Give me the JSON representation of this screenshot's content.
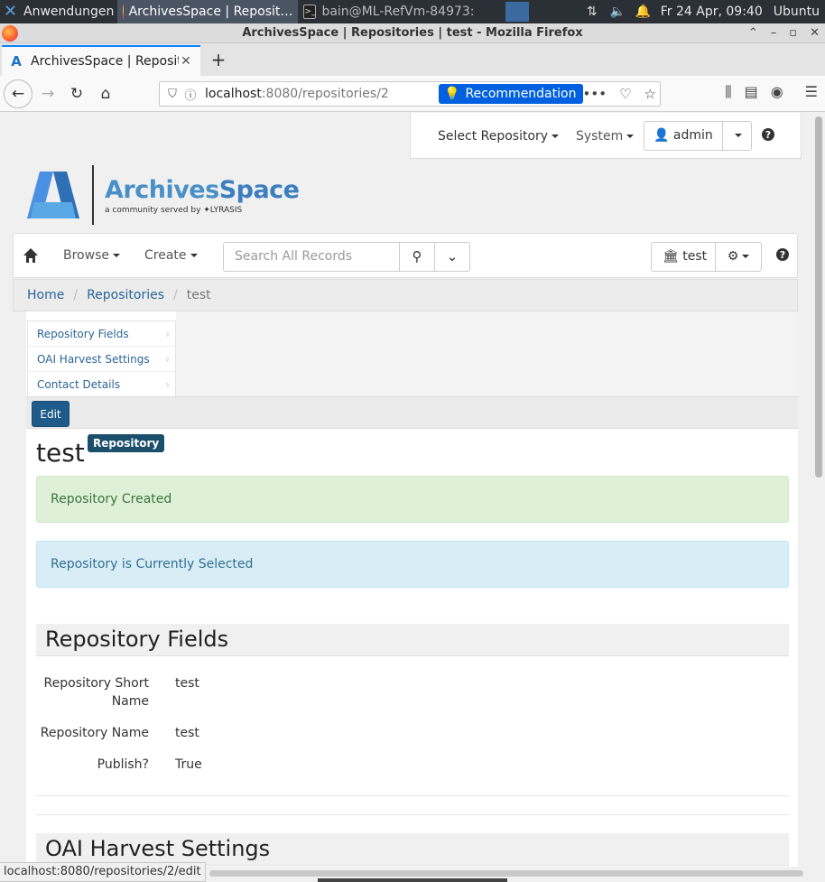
{
  "os": {
    "apps_label": "Anwendungen",
    "tasks": [
      {
        "label": "ArchivesSpace | Reposit…",
        "active": true
      },
      {
        "label": "bain@ML-RefVm-84973: ~",
        "active": false
      }
    ],
    "clock": "Fr 24 Apr, 09:40",
    "user": "Ubuntu"
  },
  "window": {
    "title": "ArchivesSpace | Repositories | test - Mozilla Firefox"
  },
  "tab": {
    "label": "ArchivesSpace | Reposito",
    "favicon": "A"
  },
  "urlbar": {
    "host": "localhost",
    "rest": ":8080/repositories/2",
    "recommendation": "Recommendation"
  },
  "repo_bar": {
    "select_repo": "Select Repository",
    "system": "System",
    "admin": "admin"
  },
  "logo": {
    "word1": "Archives",
    "word2": "Space",
    "tagline": "a community served by ✦LYRASIS"
  },
  "toolbar": {
    "browse": "Browse",
    "create": "Create",
    "search_placeholder": "Search All Records",
    "repo": "test"
  },
  "breadcrumb": {
    "home": "Home",
    "repositories": "Repositories",
    "current": "test"
  },
  "sidenav": [
    "Repository Fields",
    "OAI Harvest Settings",
    "Contact Details"
  ],
  "edit_label": "Edit",
  "record": {
    "title": "test",
    "badge": "Repository"
  },
  "alerts": {
    "created": "Repository Created",
    "selected": "Repository is Currently Selected"
  },
  "sections": {
    "fields": "Repository Fields",
    "oai": "OAI Harvest Settings"
  },
  "fields": [
    {
      "label": "Repository Short Name",
      "value": "test"
    },
    {
      "label": "Repository Name",
      "value": "test"
    },
    {
      "label": "Publish?",
      "value": "True"
    }
  ],
  "statusbar": "localhost:8080/repositories/2/edit"
}
